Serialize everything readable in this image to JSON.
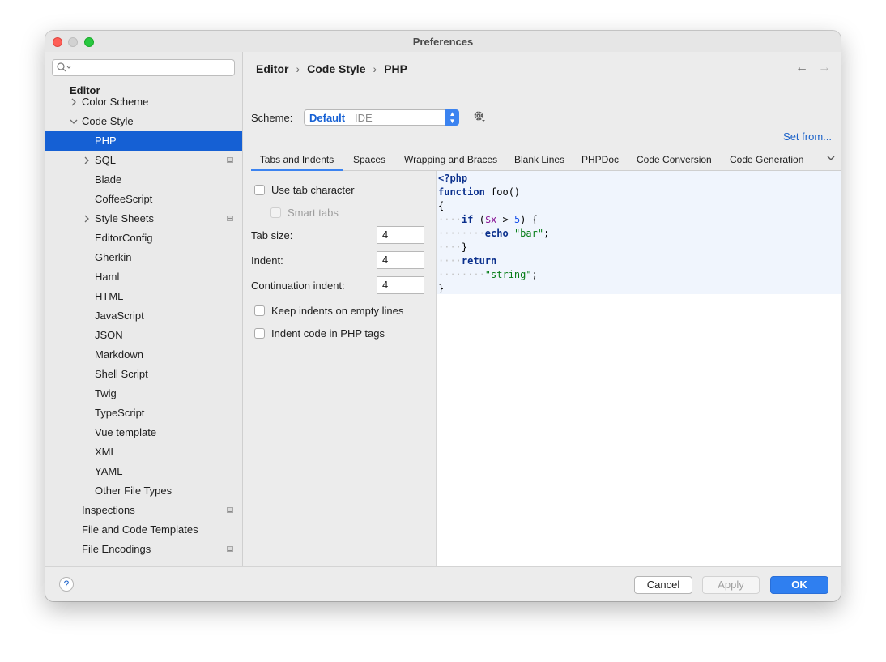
{
  "window": {
    "title": "Preferences"
  },
  "search": {
    "placeholder": ""
  },
  "sidebar": {
    "items": [
      {
        "label": "Editor",
        "level": 0,
        "bold": true
      },
      {
        "label": "Color Scheme",
        "level": 1,
        "chevron": "right"
      },
      {
        "label": "Code Style",
        "level": 1,
        "chevron": "down"
      },
      {
        "label": "PHP",
        "level": 2,
        "selected": true
      },
      {
        "label": "SQL",
        "level": 2,
        "chevron": "right",
        "marker": true
      },
      {
        "label": "Blade",
        "level": 2
      },
      {
        "label": "CoffeeScript",
        "level": 2
      },
      {
        "label": "Style Sheets",
        "level": 2,
        "chevron": "right",
        "marker": true
      },
      {
        "label": "EditorConfig",
        "level": 2
      },
      {
        "label": "Gherkin",
        "level": 2
      },
      {
        "label": "Haml",
        "level": 2
      },
      {
        "label": "HTML",
        "level": 2
      },
      {
        "label": "JavaScript",
        "level": 2
      },
      {
        "label": "JSON",
        "level": 2
      },
      {
        "label": "Markdown",
        "level": 2
      },
      {
        "label": "Shell Script",
        "level": 2
      },
      {
        "label": "Twig",
        "level": 2
      },
      {
        "label": "TypeScript",
        "level": 2
      },
      {
        "label": "Vue template",
        "level": 2
      },
      {
        "label": "XML",
        "level": 2
      },
      {
        "label": "YAML",
        "level": 2
      },
      {
        "label": "Other File Types",
        "level": 2
      },
      {
        "label": "Inspections",
        "level": 1,
        "marker": true
      },
      {
        "label": "File and Code Templates",
        "level": 1
      },
      {
        "label": "File Encodings",
        "level": 1,
        "marker": true
      }
    ]
  },
  "breadcrumb": [
    "Editor",
    "Code Style",
    "PHP"
  ],
  "nav": {
    "back": "←",
    "forward": "→"
  },
  "scheme": {
    "label": "Scheme:",
    "name": "Default",
    "sub": "IDE",
    "set_from": "Set from..."
  },
  "tabs": [
    "Tabs and Indents",
    "Spaces",
    "Wrapping and Braces",
    "Blank Lines",
    "PHPDoc",
    "Code Conversion",
    "Code Generation"
  ],
  "active_tab": 0,
  "options": {
    "use_tab": "Use tab character",
    "smart_tabs": "Smart tabs",
    "tab_size_label": "Tab size:",
    "tab_size": "4",
    "indent_label": "Indent:",
    "indent": "4",
    "cont_label": "Continuation indent:",
    "cont": "4",
    "keep_indents": "Keep indents on empty lines",
    "indent_php": "Indent code in PHP tags"
  },
  "code": {
    "l1": "<?php",
    "l2_kw": "function",
    "l2_rest": " foo()",
    "l3": "{",
    "l4_ws": "····",
    "l4_kw": "if",
    "l4_a": " (",
    "l4_var": "$x",
    "l4_b": " > ",
    "l4_num": "5",
    "l4_c": ") {",
    "l5_ws": "········",
    "l5_kw": "echo",
    "l5_sp": " ",
    "l5_str": "\"bar\"",
    "l5_end": ";",
    "l6_ws": "····",
    "l6": "}",
    "l7_ws": "····",
    "l7_kw": "return",
    "l8_ws": "········",
    "l8_str": "\"string\"",
    "l8_end": ";",
    "l9": "}"
  },
  "buttons": {
    "help": "?",
    "cancel": "Cancel",
    "apply": "Apply",
    "ok": "OK"
  },
  "colors": {
    "accent": "#1560d4",
    "ok_button": "#2f7ff0",
    "link": "#1d63c9"
  }
}
